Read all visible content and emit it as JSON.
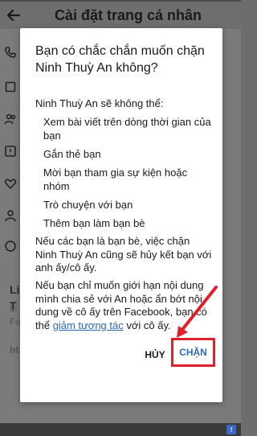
{
  "header": {
    "title": "Cài đặt trang cá nhân"
  },
  "background": {
    "left_icons": [
      "phone-icon",
      "box-icon",
      "people-icon",
      "alert-icon",
      "heart-icon",
      "person-icon",
      "circle-icon"
    ],
    "text_line_1": "Li",
    "text_line_2": "T",
    "sub_line_1": "Li",
    "sub_line_2": "Fa",
    "url_fragment": "ht"
  },
  "dialog": {
    "title": "Bạn có chắc chắn muốn chặn Ninh Thuỳ An không?",
    "intro": "Ninh Thuỳ An sẽ không thể:",
    "items": [
      "Xem bài viết trên dòng thời gian của bạn",
      "Gắn thẻ bạn",
      "Mời bạn tham gia sự kiện hoặc nhóm",
      "Trò chuyện với bạn",
      "Thêm bạn làm bạn bè"
    ],
    "para1": "Nếu các bạn là bạn bè, việc chặn Ninh Thuỳ An cũng sẽ hủy kết bạn với anh ấy/cô ấy.",
    "para2_before": "Nếu bạn chỉ muốn giới hạn nội dung mình chia sẻ với An hoặc ẩn bớt nội dung về cô ấy trên Facebook, bạn có thể ",
    "para2_link": "giảm tương tác",
    "para2_after": " với cô ấy.",
    "cancel_label": "HỦY",
    "block_label": "CHẶN"
  },
  "colors": {
    "link": "#2a6bb7",
    "highlight": "#e0202b"
  }
}
